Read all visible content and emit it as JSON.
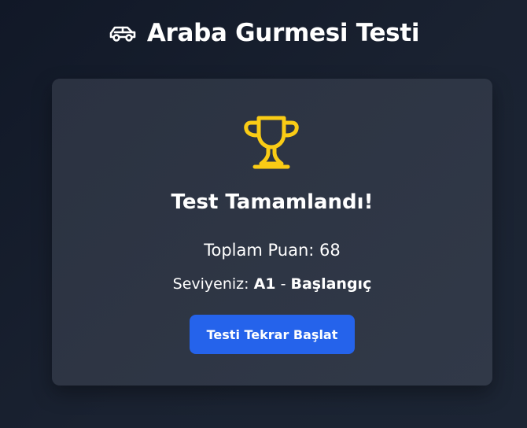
{
  "header": {
    "title": "Araba Gurmesi Testi",
    "icon": "car-icon"
  },
  "result": {
    "icon": "trophy-icon",
    "icon_color": "#facc15",
    "title": "Test Tamamlandı!",
    "score_label": "Toplam Puan:",
    "score_value": "68",
    "level_label": "Seviyeniz:",
    "level_code": "A1",
    "level_separator": "-",
    "level_name": "Başlangıç"
  },
  "actions": {
    "restart_label": "Testi Tekrar Başlat",
    "restart_color": "#2563eb"
  }
}
